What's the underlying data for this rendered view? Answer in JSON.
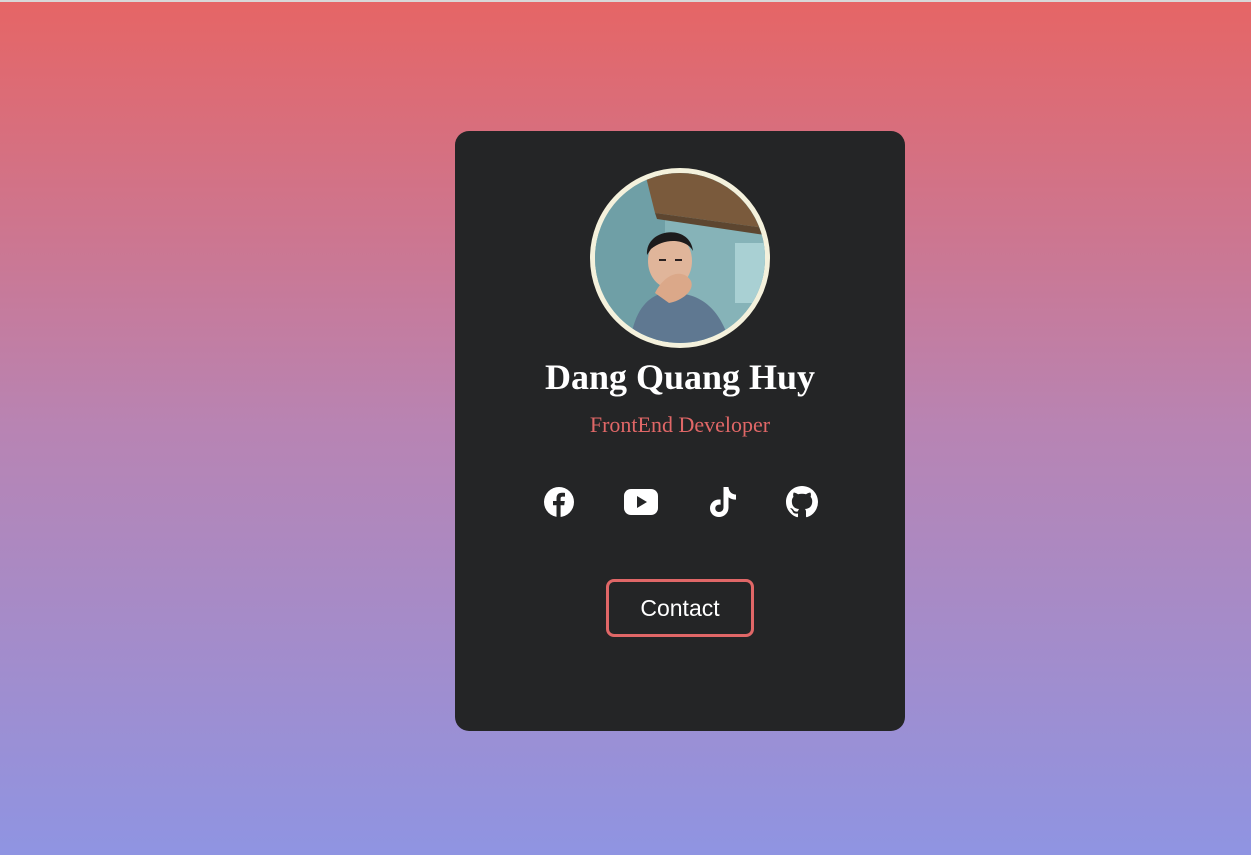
{
  "profile": {
    "name": "Dang Quang Huy",
    "role": "FrontEnd Developer",
    "avatar_icon": "profile-photo"
  },
  "socials": [
    {
      "name": "facebook",
      "icon": "facebook-icon"
    },
    {
      "name": "youtube",
      "icon": "youtube-icon"
    },
    {
      "name": "tiktok",
      "icon": "tiktok-icon"
    },
    {
      "name": "github",
      "icon": "github-icon"
    }
  ],
  "contact": {
    "label": "Contact"
  },
  "colors": {
    "gradient_top": "#e66565",
    "gradient_bottom": "#8f94e2",
    "card_background": "#242526",
    "accent": "#e06767",
    "avatar_border": "#f4f1dc"
  }
}
